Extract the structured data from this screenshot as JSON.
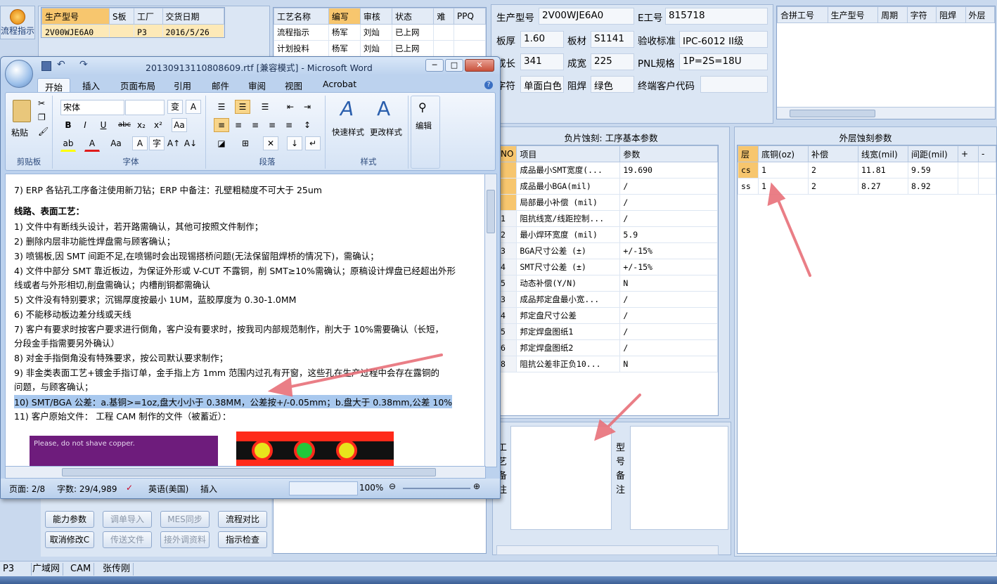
{
  "erp": {
    "flow_button_label": "流程指示",
    "order_grid": {
      "headers": [
        "生产型号",
        "S板",
        "工厂",
        "交货日期"
      ],
      "rows": [
        [
          "2V00WJE6A0",
          "",
          "P3",
          "2016/5/26"
        ]
      ]
    },
    "process_grid": {
      "headers": [
        "工艺名称",
        "编写",
        "审核",
        "状态",
        "难",
        "PPQ"
      ],
      "rows": [
        [
          "流程指示",
          "杨军",
          "刘灿",
          "已上网",
          "",
          ""
        ],
        [
          "计划投料",
          "杨军",
          "刘灿",
          "已上网",
          "",
          ""
        ]
      ]
    },
    "info": {
      "model_label": "生产型号",
      "model_value": "2V00WJE6A0",
      "e_label": "E工号",
      "e_value": "815718",
      "thick_label": "板厚",
      "thick_value": "1.60",
      "material_label": "板材",
      "material_value": "S1141",
      "standard_label": "验收标准",
      "standard_value": "IPC-6012 II级",
      "length_label": "成长",
      "length_value": "341",
      "width_label": "成宽",
      "width_value": "225",
      "pnl_label": "PNL规格",
      "pnl_value": "1P=2S=18U",
      "char_label": "字符",
      "char_value": "单面白色",
      "mask_label": "阻焊",
      "mask_value": "绿色",
      "customer_label": "终端客户代码",
      "customer_value": ""
    },
    "combine_grid": {
      "headers": [
        "合拼工号",
        "生产型号",
        "周期",
        "字符",
        "阻焊",
        "外层"
      ]
    },
    "negative_etch": {
      "title": "负片蚀刻: 工序基本参数",
      "headers": [
        "NO",
        "项目",
        "参数"
      ],
      "rows": [
        [
          "",
          "成品最小SMT宽度(...",
          "19.690"
        ],
        [
          "",
          "成品最小BGA(mil)",
          "/"
        ],
        [
          "",
          "局部最小补偿 (mil)",
          "/"
        ],
        [
          "1",
          "阻抗线宽/线距控制...",
          "/"
        ],
        [
          "2",
          "最小焊环宽度 (mil)",
          "5.9"
        ],
        [
          "3",
          "BGA尺寸公差 (±)",
          "+/-15%"
        ],
        [
          "4",
          "SMT尺寸公差 (±)",
          "+/-15%"
        ],
        [
          "5",
          "动态补偿(Y/N)",
          "N"
        ],
        [
          "3",
          "成品邦定盘最小宽...",
          "/"
        ],
        [
          "4",
          "邦定盘尺寸公差",
          "/"
        ],
        [
          "5",
          "邦定焊盘图纸1",
          "/"
        ],
        [
          "6",
          "邦定焊盘图纸2",
          "/"
        ],
        [
          "8",
          "阻抗公差非正负10...",
          "N"
        ]
      ]
    },
    "outer_etch": {
      "title": "外层蚀刻参数",
      "headers": [
        "层",
        "底铜(oz)",
        "补偿",
        "线宽(mil)",
        "间距(mil)",
        "+",
        "-"
      ],
      "rows": [
        [
          "cs",
          "1",
          "2",
          "11.81",
          "9.59",
          "",
          ""
        ],
        [
          "ss",
          "1",
          "2",
          "8.27",
          "8.92",
          "",
          ""
        ]
      ]
    },
    "note_left_label": "工艺备注",
    "note_right_label": "型号备注",
    "buttons": [
      "能力参数",
      "调单导入",
      "MES同步",
      "流程对比",
      "取消修改C",
      "传送文件",
      "接外调资料",
      "指示检查"
    ],
    "taskbar": [
      "P3",
      "广域网",
      "CAM",
      "张传刚"
    ]
  },
  "word": {
    "title": "20130913110808609.rtf [兼容模式] - Microsoft Word",
    "tabs": [
      "开始",
      "插入",
      "页面布局",
      "引用",
      "邮件",
      "审阅",
      "视图",
      "Acrobat"
    ],
    "font_name": "宋体",
    "font_size": "",
    "groups": {
      "clipboard": "剪贴板",
      "font": "字体",
      "paragraph": "段落",
      "styles": "样式",
      "paste": "粘贴",
      "quick_styles": "快速样式",
      "change_styles": "更改样式",
      "edit": "编辑"
    },
    "doc_lines": [
      "7)  ERP 各钻孔工序备注使用新刀钻；ERP 中备注：孔壁粗糙度不可大于 25um",
      "线路、表面工艺：",
      "1)  文件中有断线头设计，若开路需确认，其他可按照文件制作；",
      "2)  删除内层非功能性焊盘需与顾客确认；",
      "3)  喷锡板,因 SMT 间距不足,在喷锡时会出现锡搭桥问题(无法保留阻焊桥的情况下)，需确认；",
      "4)  文件中部分 SMT 靠近板边，为保证外形或 V-CUT 不露铜，削 SMT≥10%需确认；原稿设计焊盘已经超出外形",
      "     线或者与外形相切,削盘需确认；内槽削铜都需确认",
      "5)  文件没有特别要求；沉锡厚度按最小 1UM，蓝胶厚度为 0.30-1.0MM",
      "6)  不能移动板边差分线或天线",
      "7)  客户有要求时按客户要求进行倒角，客户没有要求时，按我司内部规范制作，削大于 10%需要确认（长短，",
      "     分段金手指需要另外确认）",
      "8)  对金手指倒角没有特殊要求，按公司默认要求制作；",
      "9)  非金类表面工艺+镀金手指订单，金手指上方 1mm 范围内过孔有开窗，这些孔在生产过程中会存在露铜的",
      "     问题，与顾客确认；",
      "10) SMT/BGA 公差：a.基铜>=1oz,盘大小小于 0.38MM，公差按+/-0.05mm；b.盘大于 0.38mm,公差 10%",
      "11)                 客户原始文件：                   工程 CAM 制作的文件（被蓄近）："
    ],
    "image_caption": "Please, do not shave copper.",
    "status": {
      "page": "页面: 2/8",
      "words": "字数: 29/4,989",
      "language": "英语(美国)",
      "mode": "插入",
      "zoom": "100%"
    }
  }
}
